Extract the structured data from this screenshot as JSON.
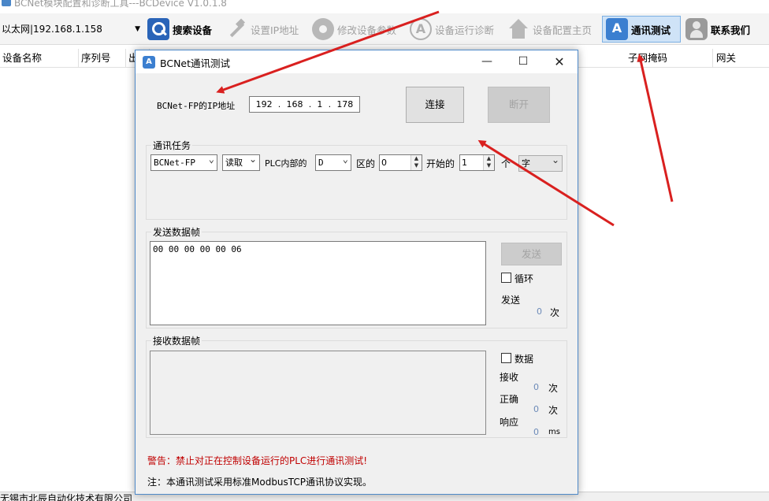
{
  "app": {
    "title": "BCNet模块配置和诊断工具---BCDevice V1.0.1.8"
  },
  "toolbar": {
    "adapter_value": "以太网|192.168.1.158",
    "buttons": [
      {
        "label": "搜索设备",
        "icon": "search-icon"
      },
      {
        "label": "设置IP地址",
        "icon": "hammer-icon"
      },
      {
        "label": "修改设备参数",
        "icon": "gear-icon"
      },
      {
        "label": "设备运行诊断",
        "icon": "app-a-icon"
      },
      {
        "label": "设备配置主页",
        "icon": "home-icon"
      },
      {
        "label": "通讯测试",
        "icon": "comm-test-icon"
      },
      {
        "label": "联系我们",
        "icon": "contact-icon"
      }
    ]
  },
  "grid": {
    "columns": [
      "设备名称",
      "序列号",
      "出",
      "子网掩码",
      "网关"
    ]
  },
  "status": {
    "company": "无锡市北辰自动化技术有限公司"
  },
  "dialog": {
    "title": "BCNet通讯测试",
    "ip_label": "BCNet-FP的IP地址",
    "ip": [
      "192",
      "168",
      "1",
      "178"
    ],
    "connect_label": "连接",
    "disconnect_label": "断开",
    "task": {
      "title": "通讯任务",
      "protocol": "BCNet-FP",
      "operation": "读取",
      "plc_label": "PLC内部的",
      "area": "D",
      "area_suffix": "区的",
      "start_value": "0",
      "start_label": "开始的",
      "count_value": "1",
      "count_unit": "个",
      "data_type": "字"
    },
    "send": {
      "title": "发送数据帧",
      "frame": "00 00 00 00 00 06",
      "send_label": "发送",
      "loop_label": "循环",
      "sent_label": "发送",
      "sent_count": "0",
      "times_unit": "次"
    },
    "receive": {
      "title": "接收数据帧",
      "data_label": "数据",
      "recv_label": "接收",
      "recv_count": "0",
      "recv_unit": "次",
      "ok_label": "正确",
      "ok_count": "0",
      "ok_unit": "次",
      "resp_label": "响应",
      "resp_value": "0",
      "resp_unit": "ms"
    },
    "warning": "警告：禁止对正在控制设备运行的PLC进行通讯测试!",
    "note": "注：本通讯测试采用标准ModbusTCP通讯协议实现。"
  },
  "annotation_arrow_color": "#d9201f",
  "accent_color": "#3b7fd0"
}
